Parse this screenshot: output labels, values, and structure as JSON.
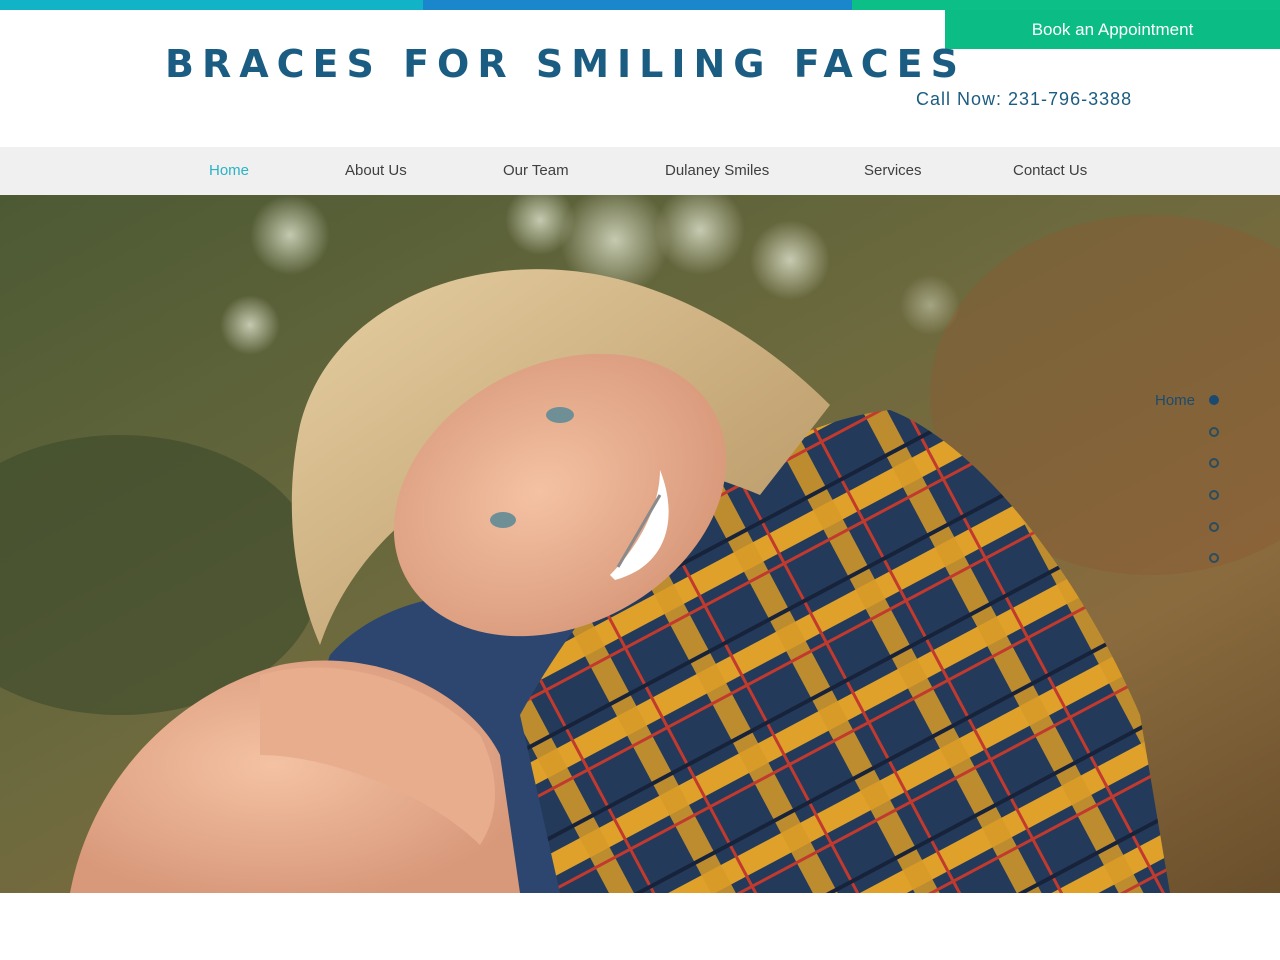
{
  "colors": {
    "top_bar": [
      "#12b3c6",
      "#1a86cc",
      "#0bbf86"
    ],
    "book_button": "#0bbc84",
    "title": "#1b5d82",
    "call_now": "#1b5d82",
    "nav_active": "#2ab3c4"
  },
  "header": {
    "book_button_label": "Book an Appointment",
    "site_title": "BRACES FOR SMILING FACES",
    "call_now": "Call Now: 231-796-3388"
  },
  "nav": {
    "items": [
      {
        "label": "Home",
        "active": true
      },
      {
        "label": "About Us",
        "active": false
      },
      {
        "label": "Our Team",
        "active": false
      },
      {
        "label": "Dulaney Smiles",
        "active": false
      },
      {
        "label": "Services",
        "active": false
      },
      {
        "label": "Contact Us",
        "active": false
      }
    ]
  },
  "hero": {
    "image": "smiling-girl-with-braces-photo"
  },
  "section_nav": {
    "active_label": "Home",
    "dot_count": 6,
    "active_index": 0
  }
}
